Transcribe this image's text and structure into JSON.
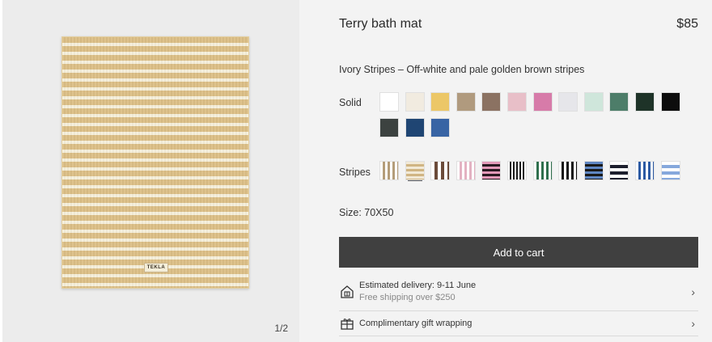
{
  "gallery": {
    "label_text": "TEKLA",
    "counter": "1/2"
  },
  "product": {
    "title": "Terry bath mat",
    "price": "$85",
    "variant_description": "Ivory Stripes – Off-white and pale golden brown stripes",
    "solid_label": "Solid",
    "stripes_label": "Stripes",
    "size_label": "Size: 70X50",
    "add_to_cart": "Add to cart"
  },
  "solid_swatches": [
    {
      "color": "#ffffff"
    },
    {
      "color": "#f1ebe0"
    },
    {
      "color": "#ecc767"
    },
    {
      "color": "#b09a7e"
    },
    {
      "color": "#8b7262"
    },
    {
      "color": "#e8bfc8"
    },
    {
      "color": "#d77ba9"
    },
    {
      "color": "#e6e6ea"
    },
    {
      "color": "#cfe6db"
    },
    {
      "color": "#4d7d69"
    },
    {
      "color": "#1e3328"
    },
    {
      "color": "#0d0d0d"
    },
    {
      "color": "#3c4240"
    },
    {
      "color": "#1f4573"
    },
    {
      "color": "#3864a4"
    }
  ],
  "stripe_swatches": [
    {
      "a": "#ffffff",
      "b": "#b49d7a",
      "dir": "vertical",
      "w": 3
    },
    {
      "a": "#f2e9d6",
      "b": "#d0b583",
      "dir": "horizontal",
      "w": 3,
      "selected": true
    },
    {
      "a": "#ffffff",
      "b": "#6b4b3a",
      "dir": "vertical",
      "w": 4
    },
    {
      "a": "#ffffff",
      "b": "#e3b2c2",
      "dir": "vertical",
      "w": 3
    },
    {
      "a": "#e39ab9",
      "b": "#2a1b22",
      "dir": "horizontal",
      "w": 3
    },
    {
      "a": "#ffffff",
      "b": "#1b1b1b",
      "dir": "vertical",
      "w": 2
    },
    {
      "a": "#ffffff",
      "b": "#2f6f4d",
      "dir": "vertical",
      "w": 3
    },
    {
      "a": "#ffffff",
      "b": "#111111",
      "dir": "vertical",
      "w": 3
    },
    {
      "a": "#5f86c2",
      "b": "#1a1a1a",
      "dir": "horizontal",
      "w": 3
    },
    {
      "a": "#ffffff",
      "b": "#1d1f2e",
      "dir": "horizontal",
      "w": 4
    },
    {
      "a": "#ffffff",
      "b": "#2c5aa3",
      "dir": "vertical",
      "w": 3
    },
    {
      "a": "#ffffff",
      "b": "#86a8dc",
      "dir": "horizontal",
      "w": 4
    }
  ],
  "delivery": {
    "title": "Estimated delivery: 9-11 June",
    "subtitle": "Free shipping over $250",
    "icon": "house-icon"
  },
  "gift": {
    "title": "Complimentary gift wrapping",
    "icon": "gift-icon"
  },
  "chevron": "›"
}
